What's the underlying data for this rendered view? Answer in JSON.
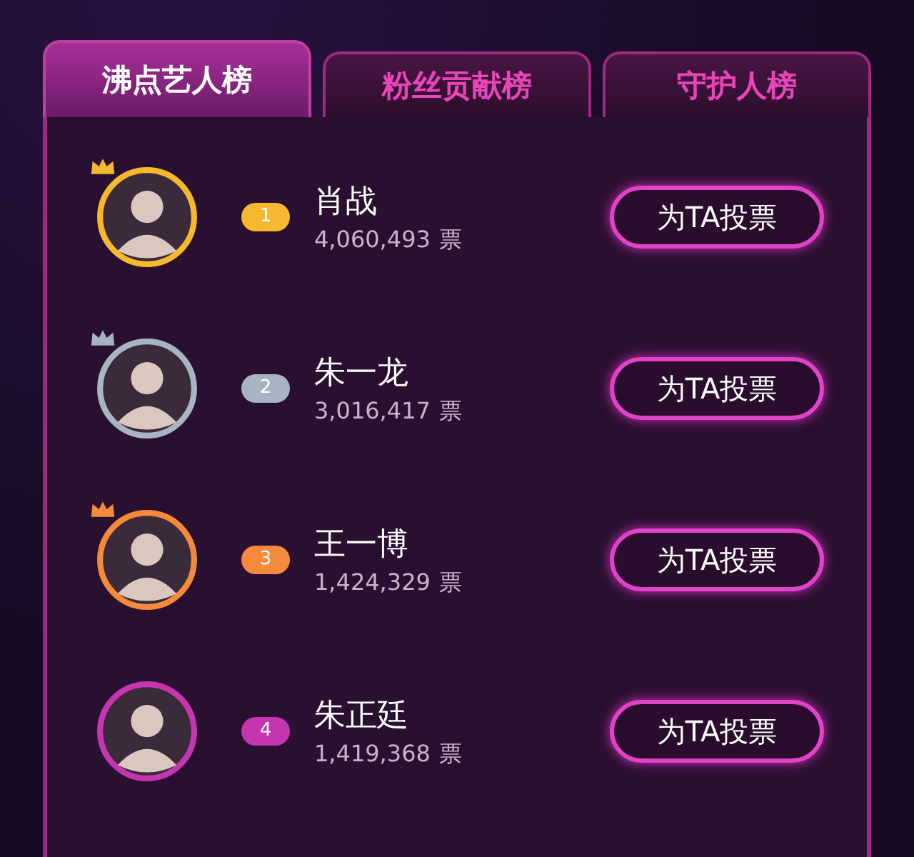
{
  "tabs": [
    {
      "label": "沸点艺人榜",
      "selected": true
    },
    {
      "label": "粉丝贡献榜",
      "selected": false
    },
    {
      "label": "守护人榜",
      "selected": false
    }
  ],
  "entries": [
    {
      "rank": "1",
      "color": "#f5b82e",
      "crowned": true,
      "name": "肖战",
      "votes": "4,060,493",
      "unit": "票",
      "button": "为TA投票"
    },
    {
      "rank": "2",
      "color": "#a9b4c2",
      "crowned": true,
      "name": "朱一龙",
      "votes": "3,016,417",
      "unit": "票",
      "button": "为TA投票"
    },
    {
      "rank": "3",
      "color": "#f58a3c",
      "crowned": true,
      "name": "王一博",
      "votes": "1,424,329",
      "unit": "票",
      "button": "为TA投票"
    },
    {
      "rank": "4",
      "color": "#c535b0",
      "crowned": false,
      "name": "朱正廷",
      "votes": "1,419,368",
      "unit": "票",
      "button": "为TA投票"
    }
  ]
}
